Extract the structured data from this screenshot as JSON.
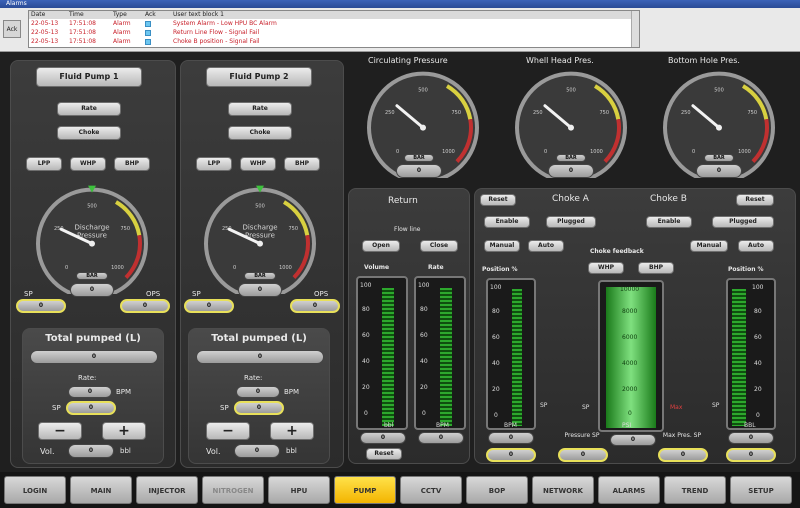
{
  "window_title": "Alarms",
  "alarm": {
    "ack": "Ack",
    "headers": [
      "Date",
      "Time",
      "Type",
      "Ack",
      "User text block 1"
    ],
    "rows": [
      {
        "date": "22-05-13",
        "time": "17:51:08",
        "type": "Alarm",
        "text": "System Alarm - Low HPU BC Alarm"
      },
      {
        "date": "22-05-13",
        "time": "17:51:08",
        "type": "Alarm",
        "text": "Return Line Flow - Signal Fail"
      },
      {
        "date": "22-05-13",
        "time": "17:51:08",
        "type": "Alarm",
        "text": "Choke B position - Signal Fail"
      }
    ]
  },
  "pump1": {
    "title": "Fluid Pump 1",
    "rate": "Rate",
    "choke": "Choke",
    "tabs": [
      "LPP",
      "WHP",
      "BHP"
    ],
    "gauge_label": "Discharge Pressure",
    "unit": "BAR",
    "value": "0",
    "min": "0",
    "max": "1000",
    "ticks": [
      "0",
      "250",
      "500",
      "750",
      "1000"
    ],
    "left": "SP",
    "right": "OPS",
    "total_label": "Total pumped (L)",
    "total": "0",
    "rate_label": "Rate:",
    "rate_value": "0",
    "rate_unit": "BPM",
    "sp": "SP",
    "sp_value": "0",
    "minus": "−",
    "plus": "+",
    "vol": "Vol.",
    "vol_value": "0",
    "vol_unit": "bbl"
  },
  "pump2": {
    "title": "Fluid Pump 2",
    "rate": "Rate",
    "choke": "Choke",
    "tabs": [
      "LPP",
      "WHP",
      "BHP"
    ],
    "gauge_label": "Discharge Pressure",
    "unit": "BAR",
    "value": "0",
    "min": "0",
    "max": "1000",
    "ticks": [
      "0",
      "250",
      "500",
      "750",
      "1000"
    ],
    "left": "SP",
    "right": "OPS",
    "total_label": "Total pumped (L)",
    "total": "0",
    "rate_label": "Rate:",
    "rate_value": "0",
    "rate_unit": "BPM",
    "sp": "SP",
    "sp_value": "0",
    "minus": "−",
    "plus": "+",
    "vol": "Vol.",
    "vol_value": "0",
    "vol_unit": "bbl"
  },
  "gauges": [
    {
      "title": "Circulating Pressure",
      "unit": "BAR",
      "value": "0",
      "ticks": [
        "0",
        "250",
        "500",
        "750",
        "1000"
      ]
    },
    {
      "title": "Whell Head Pres.",
      "unit": "BAR",
      "value": "0",
      "ticks": [
        "0",
        "250",
        "500",
        "750",
        "1000"
      ]
    },
    {
      "title": "Bottom Hole Pres.",
      "unit": "BAR",
      "value": "0",
      "ticks": [
        "0",
        "250",
        "500",
        "750",
        "1000"
      ]
    }
  ],
  "return": {
    "title": "Return",
    "flow_label": "Flow line",
    "open": "Open",
    "close": "Close",
    "volume": "Volume",
    "rate": "Rate",
    "vol_unit": "bbl",
    "rate_unit": "BPM",
    "vol_value": "0",
    "rate_value": "0",
    "reset": "Reset",
    "scale": [
      "100",
      "80",
      "60",
      "40",
      "20",
      "0"
    ],
    "vol_fill": 0.95,
    "rate_fill": 0.95
  },
  "chokeA": {
    "reset": "Reset",
    "title": "Choke A",
    "enable": "Enable",
    "plugged": "Plugged",
    "manual": "Manual",
    "auto": "Auto",
    "position": "Position %",
    "scale": [
      "100",
      "80",
      "60",
      "40",
      "20",
      "0"
    ],
    "fill": 0.95,
    "sp": "SP",
    "unit": "BPM",
    "value": "0",
    "value2": "0"
  },
  "chokeB": {
    "reset": "Reset",
    "title": "Choke B",
    "enable": "Enable",
    "plugged": "Plugged",
    "manual": "Manual",
    "auto": "Auto",
    "position": "Position %",
    "scale": [
      "100",
      "80",
      "60",
      "40",
      "20",
      "0"
    ],
    "fill": 0.95,
    "sp": "SP",
    "unit": "BBL",
    "value": "0",
    "value2": "0"
  },
  "feedback": {
    "title": "Choke feedback",
    "whp": "WHP",
    "bhp": "BHP",
    "scale": [
      "10000",
      "8000",
      "6000",
      "4000",
      "2000",
      "0"
    ],
    "unit": "PSI",
    "sp": "SP",
    "max": "Max",
    "value": "0",
    "fill": 0.98,
    "pressure_label": "Pressure SP",
    "pressure_value": "0",
    "maxpres_label": "Max Pres. SP",
    "maxpres_value": "0"
  },
  "nav": [
    {
      "label": "LOGIN"
    },
    {
      "label": "MAIN"
    },
    {
      "label": "INJECTOR"
    },
    {
      "label": "NITROGEN",
      "disabled": true
    },
    {
      "label": "HPU"
    },
    {
      "label": "PUMP",
      "active": true
    },
    {
      "label": "CCTV"
    },
    {
      "label": "BOP"
    },
    {
      "label": "NETWORK"
    },
    {
      "label": "ALARMS"
    },
    {
      "label": "TREND"
    },
    {
      "label": "SETUP"
    }
  ]
}
